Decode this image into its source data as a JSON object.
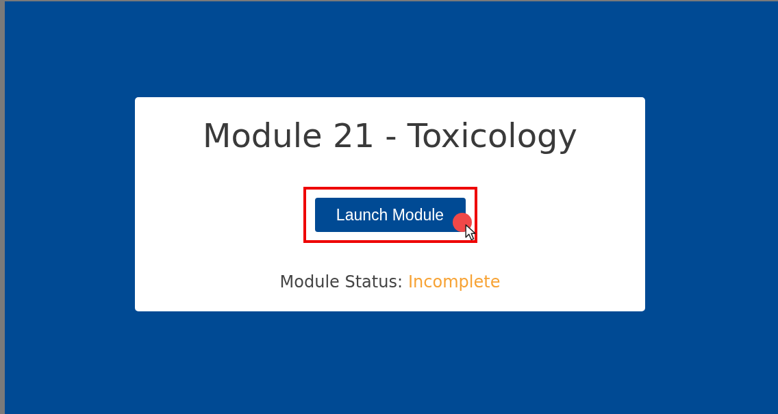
{
  "card": {
    "title": "Module 21 - Toxicology"
  },
  "launch_button": {
    "label": "Launch Module",
    "highlighted": true
  },
  "status": {
    "label": "Module Status:",
    "value": "Incomplete",
    "kind": "incomplete"
  }
}
